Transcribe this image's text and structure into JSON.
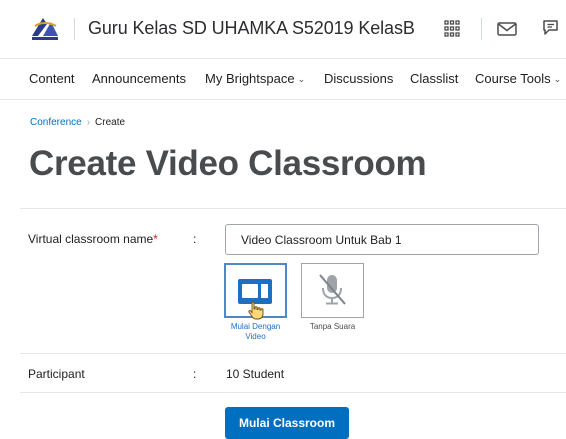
{
  "header": {
    "course_title": "Guru Kelas SD UHAMKA S52019 KelasB",
    "icons": [
      "waffle-icon",
      "mail-icon",
      "chat-icon"
    ]
  },
  "nav": {
    "items": [
      {
        "label": "Content",
        "dropdown": false
      },
      {
        "label": "Announcements",
        "dropdown": false
      },
      {
        "label": "My Brightspace",
        "dropdown": true
      },
      {
        "label": "Discussions",
        "dropdown": false
      },
      {
        "label": "Classlist",
        "dropdown": false
      },
      {
        "label": "Course Tools",
        "dropdown": true
      }
    ],
    "chevron": "⌄"
  },
  "breadcrumb": {
    "parent": "Conference",
    "separator": "›",
    "current": "Create"
  },
  "page": {
    "title": "Create Video Classroom"
  },
  "form": {
    "name_label": "Virtual classroom name",
    "required_mark": "*",
    "colon": ":",
    "name_value": "Video Classroom Untuk Bab 1",
    "options": [
      {
        "label_line1": "Mulai Dengan",
        "label_line2": "Video",
        "icon": "video-camera-icon",
        "selected": true
      },
      {
        "label_line1": "Tanpa Suara",
        "label_line2": "",
        "icon": "microphone-muted-icon",
        "selected": false
      }
    ],
    "participant_label": "Participant",
    "participant_value": "10 Student",
    "submit_label": "Mulai Classroom"
  },
  "colors": {
    "accent": "#006fbf",
    "selected_border": "#4e88c8",
    "video_icon": "#1e6fc4",
    "required": "#cd2026"
  }
}
